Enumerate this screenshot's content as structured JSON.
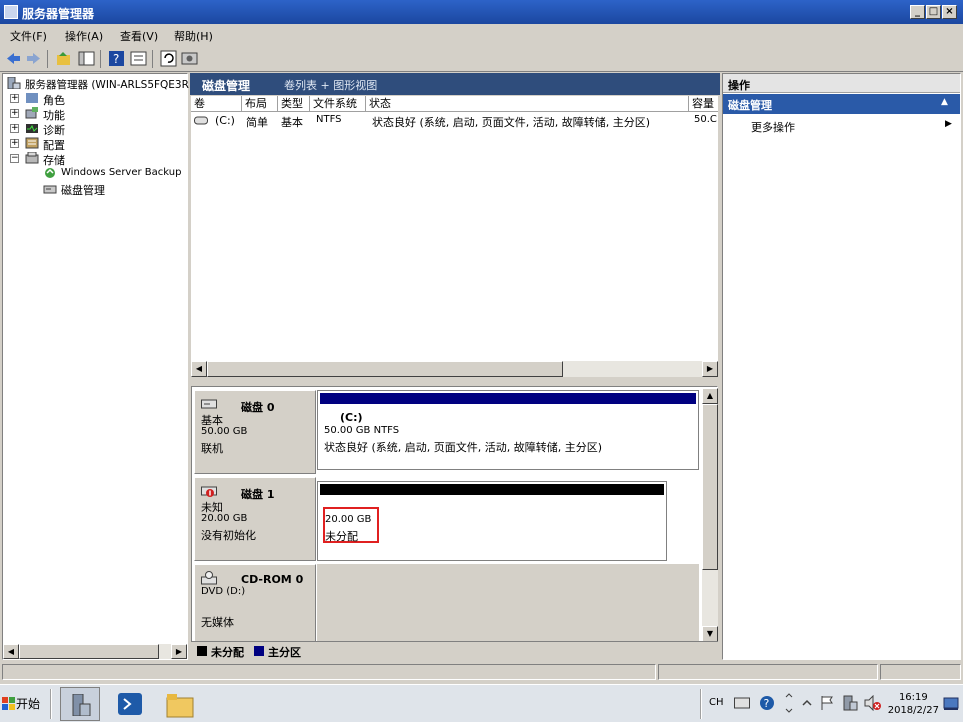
{
  "window": {
    "title": "服务器管理器",
    "min": "_",
    "max": "□",
    "close": "×"
  },
  "menubar": {
    "items": [
      "文件(F)",
      "操作(A)",
      "查看(V)",
      "帮助(H)"
    ]
  },
  "tree": {
    "root": "服务器管理器 (WIN-ARLS5FQE3R",
    "items": [
      {
        "label": "角色",
        "expander": "+"
      },
      {
        "label": "功能",
        "expander": "+"
      },
      {
        "label": "诊断",
        "expander": "+"
      },
      {
        "label": "配置",
        "expander": "+"
      },
      {
        "label": "存储",
        "expander": "−"
      }
    ],
    "children": [
      "Windows Server Backup",
      "磁盘管理"
    ]
  },
  "center": {
    "title": "磁盘管理",
    "subtitle": "卷列表 + 图形视图",
    "columns": [
      "卷",
      "布局",
      "类型",
      "文件系统",
      "状态",
      "容量"
    ],
    "row": {
      "volume": "(C:)",
      "layout": "简单",
      "type": "基本",
      "fs": "NTFS",
      "status": "状态良好 (系统, 启动, 页面文件, 活动, 故障转储, 主分区)",
      "capacity": "50.C"
    }
  },
  "disks": [
    {
      "name": "磁盘 0",
      "line1": "基本",
      "line2": "50.00 GB",
      "line3": "联机",
      "part_name": "(C:)",
      "part_size": "50.00 GB NTFS",
      "part_status": "状态良好 (系统, 启动, 页面文件, 活动, 故障转储, 主分区)"
    },
    {
      "name": "磁盘 1",
      "line1": "未知",
      "line2": "20.00 GB",
      "line3": "没有初始化",
      "part_size": "20.00 GB",
      "part_status": "未分配"
    },
    {
      "name": "CD-ROM 0",
      "line1": "DVD (D:)",
      "line3": "无媒体"
    }
  ],
  "legend": {
    "unalloc": "未分配",
    "primary": "主分区"
  },
  "actions": {
    "header": "操作",
    "section": "磁盘管理",
    "more": "更多操作"
  },
  "taskbar": {
    "start": "开始",
    "lang": "CH",
    "time": "16:19",
    "date": "2018/2/27"
  },
  "colors": {
    "accent": "#2d63c8",
    "primary_partition": "#000080",
    "unallocated": "#000000",
    "highlight_box": "#e02020"
  }
}
